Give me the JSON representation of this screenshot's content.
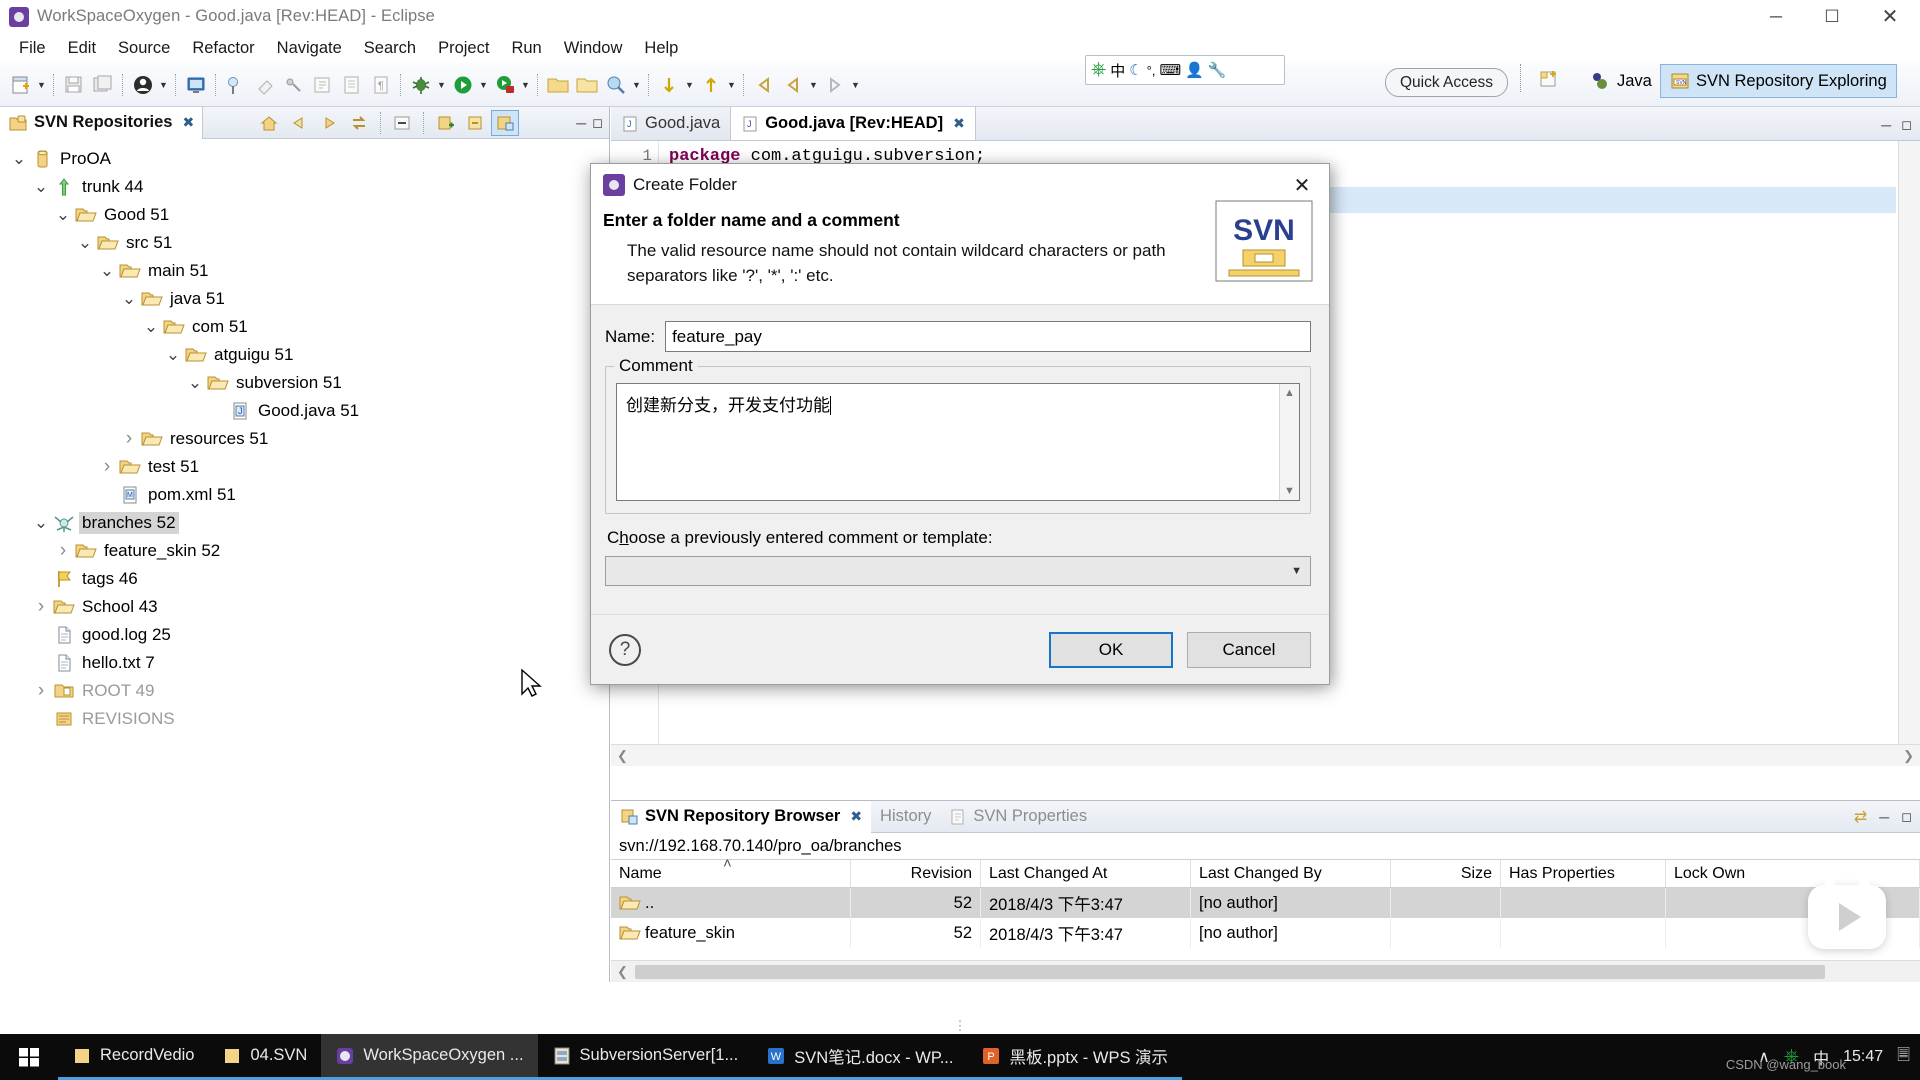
{
  "window": {
    "title": "WorkSpaceOxygen - Good.java [Rev:HEAD] - Eclipse",
    "minimize": "─",
    "maximize": "☐",
    "close": "✕"
  },
  "menubar": [
    "File",
    "Edit",
    "Source",
    "Refactor",
    "Navigate",
    "Search",
    "Project",
    "Run",
    "Window",
    "Help"
  ],
  "toolbar": {
    "ime": [
      "Ⓤ",
      "中",
      "☽",
      "°,",
      "⌨",
      "☺",
      "ὒ7"
    ],
    "quick_access": "Quick Access",
    "perspective_java": "Java",
    "perspective_svn": "SVN Repository Exploring"
  },
  "left_view": {
    "tab_label": "SVN Repositories",
    "tab_close": "✖",
    "tree": [
      {
        "label": "ProOA",
        "indent": 0,
        "twisty": "down",
        "icon": "repository",
        "selected": false,
        "dim": false
      },
      {
        "label": "trunk 44",
        "indent": 1,
        "twisty": "down",
        "icon": "trunk",
        "selected": false,
        "dim": false
      },
      {
        "label": "Good 51",
        "indent": 2,
        "twisty": "down",
        "icon": "folder",
        "selected": false,
        "dim": false
      },
      {
        "label": "src 51",
        "indent": 3,
        "twisty": "down",
        "icon": "folder",
        "selected": false,
        "dim": false
      },
      {
        "label": "main 51",
        "indent": 4,
        "twisty": "down",
        "icon": "folder",
        "selected": false,
        "dim": false
      },
      {
        "label": "java 51",
        "indent": 5,
        "twisty": "down",
        "icon": "folder",
        "selected": false,
        "dim": false
      },
      {
        "label": "com 51",
        "indent": 6,
        "twisty": "down",
        "icon": "folder",
        "selected": false,
        "dim": false
      },
      {
        "label": "atguigu 51",
        "indent": 7,
        "twisty": "down",
        "icon": "folder",
        "selected": false,
        "dim": false
      },
      {
        "label": "subversion 51",
        "indent": 8,
        "twisty": "down",
        "icon": "folder",
        "selected": false,
        "dim": false
      },
      {
        "label": "Good.java 51",
        "indent": 9,
        "twisty": "none",
        "icon": "java",
        "selected": false,
        "dim": false
      },
      {
        "label": "resources 51",
        "indent": 5,
        "twisty": "right",
        "icon": "folder",
        "selected": false,
        "dim": false
      },
      {
        "label": "test 51",
        "indent": 4,
        "twisty": "right",
        "icon": "folder",
        "selected": false,
        "dim": false
      },
      {
        "label": "pom.xml 51",
        "indent": 4,
        "twisty": "none",
        "icon": "xml",
        "selected": false,
        "dim": false
      },
      {
        "label": "branches 52",
        "indent": 1,
        "twisty": "down",
        "icon": "branch",
        "selected": true,
        "dim": false
      },
      {
        "label": "feature_skin 52",
        "indent": 2,
        "twisty": "right",
        "icon": "folder",
        "selected": false,
        "dim": false
      },
      {
        "label": "tags 46",
        "indent": 1,
        "twisty": "none",
        "icon": "tag",
        "selected": false,
        "dim": false
      },
      {
        "label": "School 43",
        "indent": 1,
        "twisty": "right",
        "icon": "folder",
        "selected": false,
        "dim": false
      },
      {
        "label": "good.log 25",
        "indent": 1,
        "twisty": "none",
        "icon": "file",
        "selected": false,
        "dim": false
      },
      {
        "label": "hello.txt 7",
        "indent": 1,
        "twisty": "none",
        "icon": "file",
        "selected": false,
        "dim": false
      },
      {
        "label": "ROOT 49",
        "indent": 1,
        "twisty": "right",
        "icon": "folder-dim",
        "selected": false,
        "dim": true
      },
      {
        "label": "REVISIONS",
        "indent": 1,
        "twisty": "none",
        "icon": "revisions",
        "selected": false,
        "dim": true
      }
    ]
  },
  "editor": {
    "tabs": [
      {
        "label": "Good.java",
        "active": false,
        "close": ""
      },
      {
        "label": "Good.java [Rev:HEAD]",
        "active": true,
        "close": "✖"
      }
    ],
    "line_number": "1",
    "code_keyword": "package",
    "code_rest": " com.atguigu.subversion;"
  },
  "bottom_view": {
    "tabs": [
      {
        "label": "SVN Repository Browser",
        "active": true,
        "close": "✖"
      },
      {
        "label": "History",
        "active": false,
        "close": ""
      },
      {
        "label": "SVN Properties",
        "active": false,
        "close": ""
      }
    ],
    "url": "svn://192.168.70.140/pro_oa/branches",
    "columns": [
      "Name",
      "Revision",
      "Last Changed At",
      "Last Changed By",
      "Size",
      "Has Properties",
      "Lock Own"
    ],
    "sort_indicator": "˄",
    "rows": [
      {
        "name": "..",
        "revision": "52",
        "changed_at": "2018/4/3 下午3:47",
        "changed_by": "[no author]",
        "size": "",
        "has_properties": "",
        "lock_owner": "",
        "selected": true
      },
      {
        "name": "feature_skin",
        "revision": "52",
        "changed_at": "2018/4/3 下午3:47",
        "changed_by": "[no author]",
        "size": "",
        "has_properties": "",
        "lock_owner": "",
        "selected": false
      }
    ]
  },
  "dialog": {
    "title": "Create Folder",
    "close": "✕",
    "heading": "Enter a folder name and a comment",
    "description": "The valid resource name should not contain wildcard characters or path separators like '?', '*', ':' etc.",
    "logo_text": "SVN",
    "name_label": "Name:",
    "name_value": "feature_pay",
    "comment_group_label": "Comment",
    "comment_value": "创建新分支，开发支付功能",
    "choose_label_pre": "C",
    "choose_label_accel": "h",
    "choose_label_post": "oose a previously entered comment or template:",
    "template_value": "",
    "help_glyph": "?",
    "ok_label": "OK",
    "cancel_label": "Cancel"
  },
  "taskbar": {
    "items": [
      {
        "label": "RecordVedio",
        "icon": "folder-yellow",
        "active": false,
        "underline": true
      },
      {
        "label": "04.SVN",
        "icon": "folder-yellow",
        "active": false,
        "underline": true
      },
      {
        "label": "WorkSpaceOxygen ...",
        "icon": "eclipse",
        "active": true,
        "underline": true
      },
      {
        "label": "SubversionServer[1...",
        "icon": "server",
        "active": false,
        "underline": true
      },
      {
        "label": "SVN笔记.docx - WP...",
        "icon": "word",
        "active": false,
        "underline": true
      },
      {
        "label": "黑板.pptx - WPS 演示",
        "icon": "ppt",
        "active": false,
        "underline": true
      }
    ],
    "tray_chevron": "∧",
    "tray_ime": "中",
    "clock": "15:47",
    "watermark": "CSDN @wang_book"
  }
}
